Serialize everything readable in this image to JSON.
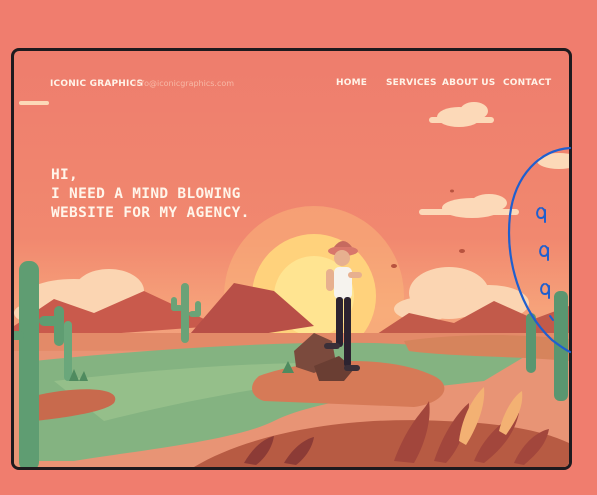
{
  "header": {
    "brand": "ICONIC GRAPHICS",
    "email": "info@iconicgraphics.com"
  },
  "nav": {
    "home": "HOME",
    "services": "SERVICES",
    "about": "ABOUT US",
    "contact": "CONTACT"
  },
  "hero": {
    "line1": "HI,",
    "line2": "I NEED A MIND BLOWING",
    "line3": "WEBSITE FOR MY AGENCY."
  },
  "colors": {
    "sky": "#ee7d6d",
    "sun": "#ffe27a",
    "water": "#7fb27f",
    "cactus": "#5f9d72",
    "ground": "#c86a4d",
    "annotation": "#1f5fcf"
  }
}
